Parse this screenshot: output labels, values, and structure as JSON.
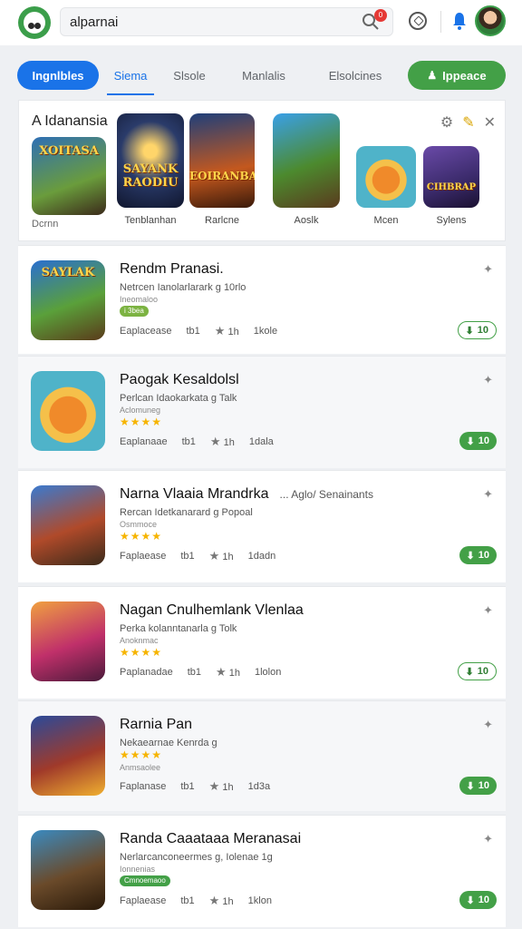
{
  "header": {
    "search_value": "alparnai",
    "search_badge": "0"
  },
  "tabs": [
    {
      "label": "Ingnlbles"
    },
    {
      "label": "Siema"
    },
    {
      "label": "Slsole"
    },
    {
      "label": "Manlalis"
    },
    {
      "label": "Elsolcines"
    },
    {
      "label": "Ippeace"
    }
  ],
  "featured": {
    "title": "A Idanansia",
    "sub": "Dcrnn",
    "cards": [
      {
        "art": "XOITASA",
        "label": ""
      },
      {
        "art": "SAYANK RAODIU",
        "label": "Tenblanhan"
      },
      {
        "art": "EOIRANBAI",
        "label": "Rarlcne"
      },
      {
        "art": "",
        "label": "Aoslk"
      },
      {
        "art": "",
        "label": "Mcen"
      },
      {
        "art": "CIHBRAP",
        "label": "Sylens"
      }
    ]
  },
  "apps": [
    {
      "title": "Rendm Pranasi.",
      "extra": "",
      "sub": "Netrcen Ianolarlarark g 10rlo",
      "sub2": "Ineomaloo",
      "rating_badge": "i 3bea",
      "stars": "",
      "meta_a": "Eaplacease",
      "meta_b": "tb1",
      "meta_c": "1h",
      "meta_d": "1kole",
      "button": "10",
      "art": "SAYLAK"
    },
    {
      "title": "Paogak Kesaldolsl",
      "extra": "",
      "sub": "Perlcan Idaokarkata g Talk",
      "sub2": "Aclomuneg",
      "rating_badge": "",
      "stars": "★★★★",
      "meta_a": "Eaplanaae",
      "meta_b": "tb1",
      "meta_c": "1h",
      "meta_d": "1dala",
      "button": "10",
      "art": ""
    },
    {
      "title": "Narna Vlaaia Mrandrka",
      "extra": "...  Aglo/       Senainants",
      "sub": "Rercan Idetkanarard g Popoal",
      "sub2": "Osmmoce",
      "rating_badge": "",
      "stars": "★★★★",
      "meta_a": "Faplaease",
      "meta_b": "tb1",
      "meta_c": "1h",
      "meta_d": "1dadn",
      "button": "10",
      "art": ""
    },
    {
      "title": "Nagan Cnulhemlank Vlenlaa",
      "extra": "",
      "sub": "Perka kolanntanarla g Tolk",
      "sub2": "Anoknmac",
      "rating_badge": "",
      "stars": "★★★★",
      "meta_a": "Paplanadae",
      "meta_b": "tb1",
      "meta_c": "1h",
      "meta_d": "1lolon",
      "button": "10",
      "art": ""
    },
    {
      "title": "Rarnia Pan",
      "extra": "",
      "sub": "Nekaearnae Kenrda g",
      "sub2": "Anmsaolee",
      "rating_badge": "",
      "stars": "★★★★",
      "meta_a": "Faplanase",
      "meta_b": "tb1",
      "meta_c": "1h",
      "meta_d": "1d3a",
      "button": "10",
      "art": ""
    },
    {
      "title": "Randa Caaataaa Meranasai",
      "extra": "",
      "sub": "Nerlarcanconeermes g, Iolenae 1g",
      "sub2": "Ionnenias",
      "rating_badge": "Cmnoemaoo",
      "stars": "",
      "meta_a": "Faplaease",
      "meta_b": "tb1",
      "meta_c": "1h",
      "meta_d": "1klon",
      "button": "10",
      "art": ""
    }
  ]
}
